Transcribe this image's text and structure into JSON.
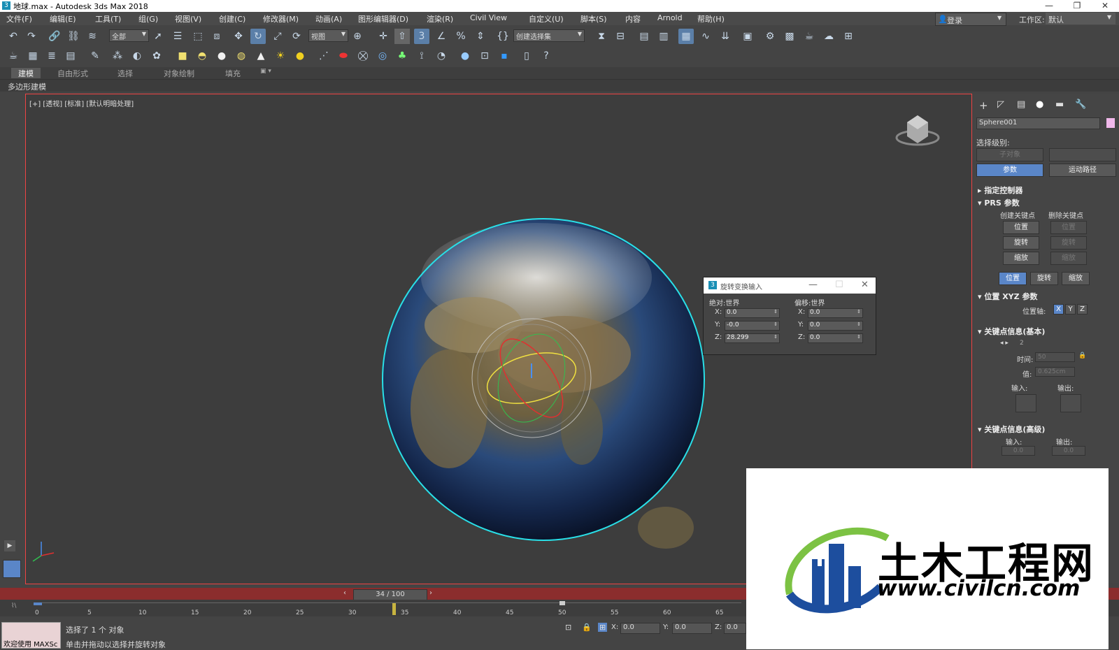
{
  "window": {
    "title": "地球.max - Autodesk 3ds Max 2018",
    "min": "—",
    "restore": "❐",
    "close": "✕"
  },
  "menubar": {
    "items": [
      "文件(F)",
      "编辑(E)",
      "工具(T)",
      "组(G)",
      "视图(V)",
      "创建(C)",
      "修改器(M)",
      "动画(A)",
      "图形编辑器(D)",
      "渲染(R)",
      "Civil View",
      "自定义(U)",
      "脚本(S)",
      "内容",
      "Arnold",
      "帮助(H)"
    ],
    "login_label": "登录",
    "workspace_label": "工作区:",
    "workspace_value": "默认"
  },
  "toolbar": {
    "selection_filter": "全部",
    "ref_coord": "视图",
    "named_selection": "创建选择集",
    "snap_value": "3"
  },
  "ribbon": {
    "tabs": [
      "建模",
      "自由形式",
      "选择",
      "对象绘制",
      "填充"
    ],
    "active_tab": "建模",
    "sub_label": "多边形建模"
  },
  "viewport": {
    "label": "[+] [透视] [标准] [默认明暗处理]"
  },
  "command_panel": {
    "object_name": "Sphere001",
    "selection_level_label": "选择级别:",
    "sub_object": "子对象",
    "params_button": "参数",
    "trajectory_button": "运动路径",
    "assign_controller": "指定控制器",
    "prs_params": "PRS 参数",
    "create_key_label": "创建关键点",
    "delete_key_label": "删除关键点",
    "create_buttons": [
      "位置",
      "旋转",
      "缩放"
    ],
    "delete_buttons": [
      "位置",
      "旋转",
      "缩放"
    ],
    "mode_buttons": [
      "位置",
      "旋转",
      "缩放"
    ],
    "pos_xyz_params": "位置 XYZ 参数",
    "pos_axis_label": "位置轴:",
    "axis_buttons": [
      "X",
      "Y",
      "Z"
    ],
    "key_info_basic": "关键点信息(基本)",
    "key_index": "2",
    "time_label": "时间:",
    "time_value": "50",
    "value_label": "值:",
    "value_value": "0.625cm",
    "in_label": "输入:",
    "out_label": "输出:",
    "key_info_adv": "关键点信息(高级)",
    "adv_in_label": "输入:",
    "adv_out_label": "输出:",
    "adv_in_value": "0.0",
    "adv_out_value": "0.0"
  },
  "rotate_dialog": {
    "title": "旋转变换输入",
    "absolute_label": "绝对:世界",
    "offset_label": "偏移:世界",
    "abs": {
      "x": "0.0",
      "y": "-0.0",
      "z": "28.299"
    },
    "off": {
      "x": "0.0",
      "y": "0.0",
      "z": "0.0"
    },
    "axis_x": "X:",
    "axis_y": "Y:",
    "axis_z": "Z:"
  },
  "timeline": {
    "frame_display": "34 / 100",
    "ticks": [
      "0",
      "5",
      "10",
      "15",
      "20",
      "25",
      "30",
      "35",
      "40",
      "45",
      "50",
      "55",
      "60",
      "65"
    ]
  },
  "status": {
    "welcome": "欢迎使用 MAXSc",
    "selected": "选择了 1 个 对象",
    "hint": "单击并拖动以选择并旋转对象",
    "x_label": "X:",
    "x_value": "0.0",
    "y_label": "Y:",
    "y_value": "0.0",
    "z_label": "Z:",
    "z_value": "0.0"
  },
  "watermark": {
    "cn": "土木工程网",
    "url": "www.civilcn.com"
  },
  "colors": {
    "accent": "#5a86c8",
    "viewport_border": "#ee4444",
    "timeline": "#8b2d2d",
    "selection_outline": "#29e0e8"
  }
}
